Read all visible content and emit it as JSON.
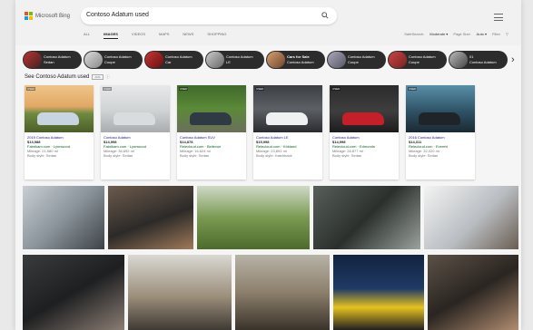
{
  "brand": {
    "name": "Microsoft Bing"
  },
  "search": {
    "query": "Contoso Adatum used"
  },
  "nav": {
    "tabs": [
      "ALL",
      "IMAGES",
      "VIDEOS",
      "MAPS",
      "NEWS",
      "SHOPPING"
    ],
    "active": "IMAGES"
  },
  "filters": {
    "safesearch_label": "SafeSearch:",
    "safesearch_value": "Moderate ▾",
    "pagesize_label": "Page Size:",
    "pagesize_value": "Auto ▾",
    "filter_label": "Filter"
  },
  "chips": [
    {
      "line1": "Contoso Adatum",
      "line2": "Sedan"
    },
    {
      "line1": "Contoso Adatum",
      "line2": "Coupe"
    },
    {
      "line1": "Contoso Adatum",
      "line2": "Car"
    },
    {
      "line1": "Contoso Adatum",
      "line2": "LE"
    },
    {
      "line1": "Cars for Sale",
      "line2": "Contoso Adatum"
    },
    {
      "line1": "Contoso Adatum",
      "line2": "Coupe"
    },
    {
      "line1": "Contoso Adatum",
      "line2": "Coupe"
    },
    {
      "line1": "01",
      "line2": "Contoso Adatum"
    }
  ],
  "see_section": {
    "heading": "See Contoso Adatum used",
    "badge": "ADS"
  },
  "cards": [
    {
      "used_tag": "USED",
      "title": "2019 Contoso Adatum",
      "price": "$13,988",
      "seller": "Fabrikam.com · Lynnwood",
      "mileage": "Mileage: 21,580 mi",
      "body": "Body style: Sedan",
      "car_color": "#c8d4df"
    },
    {
      "used_tag": "USED",
      "title": "Contoso Adatum",
      "price": "$14,998",
      "seller": "Fabrikam.com · Lynnwood",
      "mileage": "Mileage: 36,892 mi",
      "body": "Body style: Sedan",
      "car_color": "#d9dcdf"
    },
    {
      "used_tag": "USED",
      "title": "Contoso Adatum SUV",
      "price": "$14,878",
      "seller": "Relecloud.com · Bellevue",
      "mileage": "Mileage: 16,624 mi",
      "body": "Body style: Sedan",
      "car_color": "#2f3a45"
    },
    {
      "used_tag": "USED",
      "title": "Contoso Adatum LE",
      "price": "$15,998",
      "seller": "Relecloud.com · Kirkland",
      "mileage": "Mileage: 23,891 mi",
      "body": "Body style: Hatchback",
      "car_color": "#eef0f2"
    },
    {
      "used_tag": "USED",
      "title": "Contoso Adatum",
      "price": "$14,998",
      "seller": "Relecloud.com · Edmonds",
      "mileage": "Mileage: 28,877 mi",
      "body": "Body style: Sedan",
      "car_color": "#c61f2a"
    },
    {
      "used_tag": "USED",
      "title": "2016 Contoso Adatum",
      "price": "$14,311",
      "seller": "Relecloud.com · Everett",
      "mileage": "Mileage: 32,020 mi",
      "body": "Body style: Sedan",
      "car_color": "#1f2429"
    }
  ],
  "colors": {
    "link": "#1a0dab",
    "seller": "#006621",
    "chip_bg": "#2c2c2c"
  }
}
